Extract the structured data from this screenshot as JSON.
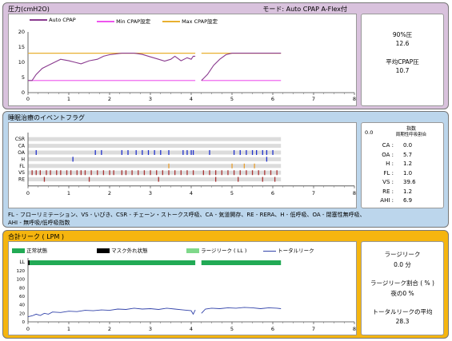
{
  "pressure": {
    "title": "圧力(cmH2O)",
    "mode": "モード: Auto CPAP A-Flex付",
    "legend": [
      {
        "label": "Auto CPAP",
        "color": "#8a3b8f"
      },
      {
        "label": "Min CPAP設定",
        "color": "#ee55ee"
      },
      {
        "label": "Max CPAP設定",
        "color": "#e8b030"
      }
    ],
    "stats": {
      "p90_label": "90%圧",
      "p90_value": "12.6",
      "avg_label": "平均CPAP圧",
      "avg_value": "10.7"
    }
  },
  "events": {
    "title": "睡眠治療のイベントフラグ",
    "rows": [
      "CSR",
      "CA",
      "OA",
      "H",
      "FL",
      "VS",
      "RE"
    ],
    "index": {
      "zero": "0.0",
      "title_line1": "指数",
      "title_line2": "周期性呼吸割合",
      "items": [
        {
          "label": "CA :",
          "value": "0.0"
        },
        {
          "label": "OA :",
          "value": "5.7"
        },
        {
          "label": "H :",
          "value": "1.2"
        },
        {
          "label": "FL :",
          "value": "1.0"
        },
        {
          "label": "VS :",
          "value": "39.6"
        },
        {
          "label": "RE :",
          "value": "1.2"
        },
        {
          "label": "AHI :",
          "value": "6.9"
        }
      ]
    },
    "footnote_line1": "FL - フローリミテーション、VS - いびき、CSR - チェーン・ストークス呼吸、CA - 気道開存、RE - RERA、H - 低呼吸、OA - 閉塞性無呼吸、",
    "footnote_line2": "AHI - 無呼吸/低呼吸指数"
  },
  "leak": {
    "title": "合計リーク ( LPM )",
    "legend": [
      {
        "label": "正常状態",
        "color": "#22aa55"
      },
      {
        "label": "マスク外れ状態",
        "color": "#000000"
      },
      {
        "label": "ラージリーク ( LL )",
        "color": "#7fd88a"
      },
      {
        "label": "トータルリーク",
        "color": "#3344aa"
      }
    ],
    "stats": {
      "large_leak_label": "ラージリーク",
      "large_leak_value": "0.0 分",
      "ratio_label": "ラージリーク割合 ( % )",
      "ratio_value": "夜の0 %",
      "avg_label": "トータルリークの平均",
      "avg_value": "28.3"
    }
  },
  "chart_data": [
    {
      "type": "line",
      "title": "圧力(cmH2O)",
      "xlim": [
        0,
        8
      ],
      "ylim": [
        0,
        20
      ],
      "x_ticks": [
        "0",
        "1",
        "2",
        "3",
        "4",
        "5",
        "6",
        "7",
        "8"
      ],
      "y_ticks": [
        "0",
        "5",
        "10",
        "15",
        "20"
      ],
      "series": [
        {
          "name": "Auto CPAP",
          "points": [
            [
              0,
              4
            ],
            [
              0.1,
              4
            ],
            [
              0.2,
              6
            ],
            [
              0.35,
              8
            ],
            [
              0.5,
              9
            ],
            [
              0.65,
              10
            ],
            [
              0.8,
              11
            ],
            [
              1.0,
              10.5
            ],
            [
              1.15,
              10
            ],
            [
              1.3,
              9.5
            ],
            [
              1.5,
              10.5
            ],
            [
              1.7,
              11
            ],
            [
              1.85,
              12
            ],
            [
              2.0,
              12.5
            ],
            [
              2.3,
              13
            ],
            [
              2.6,
              13
            ],
            [
              2.8,
              12.6
            ],
            [
              3.0,
              11.8
            ],
            [
              3.2,
              11
            ],
            [
              3.35,
              10.4
            ],
            [
              3.5,
              11
            ],
            [
              3.6,
              12
            ],
            [
              3.75,
              10.5
            ],
            [
              3.9,
              11.5
            ],
            [
              4.0,
              11
            ],
            [
              4.05,
              12
            ],
            [
              4.1,
              12
            ],
            null,
            [
              4.25,
              4
            ],
            [
              4.4,
              6
            ],
            [
              4.55,
              9
            ],
            [
              4.7,
              11
            ],
            [
              4.85,
              12.5
            ],
            [
              5.0,
              13
            ],
            [
              5.5,
              13
            ],
            [
              6.0,
              13
            ],
            [
              6.2,
              13
            ]
          ]
        },
        {
          "name": "Min CPAP設定",
          "points": [
            [
              0,
              4
            ],
            [
              4.1,
              4
            ],
            null,
            [
              4.25,
              4
            ],
            [
              6.2,
              4
            ]
          ]
        },
        {
          "name": "Max CPAP設定",
          "points": [
            [
              0,
              13
            ],
            [
              4.1,
              13
            ],
            null,
            [
              4.25,
              13
            ],
            [
              6.2,
              13
            ]
          ]
        }
      ]
    },
    {
      "type": "scatter",
      "title": "睡眠治療のイベントフラグ",
      "xlim": [
        0,
        8
      ],
      "x_ticks": [
        "0",
        "1",
        "2",
        "3",
        "4",
        "5",
        "6",
        "7",
        "8"
      ],
      "categories": [
        "CSR",
        "CA",
        "OA",
        "H",
        "FL",
        "VS",
        "RE"
      ],
      "series": [
        {
          "name": "OA",
          "x": [
            0.2,
            1.65,
            1.8,
            2.3,
            2.45,
            2.65,
            2.8,
            2.95,
            3.1,
            3.25,
            3.45,
            3.8,
            3.9,
            4.0,
            4.05,
            4.45,
            5.05,
            5.2,
            5.35,
            5.5,
            5.6,
            5.75,
            5.85,
            6.0
          ],
          "color": "#2233cc"
        },
        {
          "name": "H",
          "x": [
            1.1,
            5.85
          ],
          "color": "#2233cc"
        },
        {
          "name": "FL",
          "x": [
            3.45,
            5.0,
            5.3,
            5.55
          ],
          "color": "#e8a030"
        },
        {
          "name": "VS",
          "x": [
            0.1,
            0.2,
            0.3,
            0.45,
            0.55,
            0.7,
            0.8,
            0.95,
            1.05,
            1.2,
            1.3,
            1.4,
            1.55,
            1.7,
            1.85,
            2.0,
            2.1,
            2.3,
            2.4,
            2.55,
            2.7,
            2.85,
            3.0,
            3.15,
            3.3,
            3.45,
            3.6,
            3.75,
            3.9,
            4.05,
            4.3,
            4.45,
            4.6,
            4.75,
            4.9,
            5.05,
            5.2,
            5.35,
            5.5,
            5.65,
            5.8,
            5.95,
            6.1
          ],
          "color": "#aa3333"
        },
        {
          "name": "RE",
          "x": [
            0.4,
            1.5,
            3.2,
            4.6,
            5.15,
            5.75,
            6.05
          ],
          "color": "#aa3333"
        }
      ]
    },
    {
      "type": "line",
      "title": "合計リーク ( LPM )",
      "xlim": [
        0,
        8
      ],
      "ylim": [
        0,
        120
      ],
      "x_ticks": [
        "0",
        "1",
        "2",
        "3",
        "4",
        "5",
        "6",
        "7",
        "8"
      ],
      "y_ticks": [
        "0",
        "20",
        "40",
        "60",
        "80",
        "100",
        "120"
      ],
      "ll_bar_segments": [
        [
          0,
          4.1
        ],
        [
          4.25,
          6.2
        ]
      ],
      "series": [
        {
          "name": "トータルリーク",
          "points": [
            [
              0,
              12
            ],
            [
              0.1,
              14
            ],
            [
              0.2,
              18
            ],
            [
              0.3,
              15
            ],
            [
              0.4,
              20
            ],
            [
              0.5,
              18
            ],
            [
              0.6,
              23
            ],
            [
              0.8,
              22
            ],
            [
              1.0,
              25
            ],
            [
              1.2,
              24
            ],
            [
              1.4,
              27
            ],
            [
              1.6,
              26
            ],
            [
              1.8,
              28
            ],
            [
              2.0,
              27
            ],
            [
              2.2,
              30
            ],
            [
              2.4,
              29
            ],
            [
              2.6,
              32
            ],
            [
              2.8,
              30
            ],
            [
              3.0,
              31
            ],
            [
              3.2,
              29
            ],
            [
              3.4,
              32
            ],
            [
              3.6,
              30
            ],
            [
              3.8,
              28
            ],
            [
              4.0,
              26
            ],
            [
              4.05,
              18
            ],
            [
              4.1,
              28
            ],
            null,
            [
              4.25,
              20
            ],
            [
              4.35,
              30
            ],
            [
              4.5,
              32
            ],
            [
              4.7,
              31
            ],
            [
              4.9,
              33
            ],
            [
              5.1,
              32
            ],
            [
              5.3,
              34
            ],
            [
              5.5,
              33
            ],
            [
              5.7,
              31
            ],
            [
              5.9,
              33
            ],
            [
              6.1,
              32
            ],
            [
              6.2,
              31
            ]
          ]
        }
      ]
    }
  ]
}
